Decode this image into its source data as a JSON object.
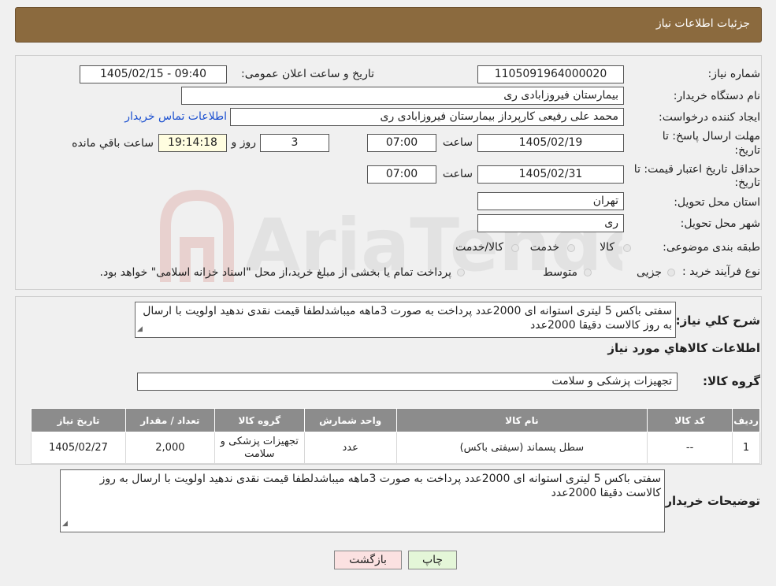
{
  "header": {
    "title": "جزئیات اطلاعات نیاز"
  },
  "details": {
    "need_number_label": "شماره نیاز:",
    "need_number": "1105091964000020",
    "announce_label": "تاریخ و ساعت اعلان عمومی:",
    "announce_value": "1405/02/15 - 09:40",
    "buyer_org_label": "نام دستگاه خریدار:",
    "buyer_org": "بیمارستان فیروزابادی ری",
    "creator_label": "ایجاد کننده درخواست:",
    "creator": "محمد علی رفیعی کارپرداز بیمارستان فیروزابادی ری",
    "contact_link": "اطلاعات تماس خریدار",
    "deadline_label_1": "مهلت ارسال پاسخ: تا",
    "deadline_label_2": "تاریخ:",
    "deadline_date": "1405/02/19",
    "time_label": "ساعت",
    "deadline_time": "07:00",
    "days_value": "3",
    "days_label": "روز و",
    "remaining_time": "19:14:18",
    "remaining_label": "ساعت باقي مانده",
    "validity_label_1": "حداقل تاریخ اعتبار قیمت: تا",
    "validity_label_2": "تاریخ:",
    "validity_date": "1405/02/31",
    "validity_time_label": "ساعت",
    "validity_time": "07:00",
    "province_label": "استان محل تحویل:",
    "province": "تهران",
    "city_label": "شهر محل تحویل:",
    "city": "ری",
    "category_label": "طبقه بندی موضوعی:",
    "category_options": [
      "کالا",
      "خدمت",
      "کالا/خدمت"
    ],
    "process_label": "نوع فرآیند خرید :",
    "process_options": [
      "جزیی",
      "متوسط"
    ],
    "process_note": "پرداخت تمام یا بخشی از مبلغ خرید،از محل \"اسناد خزانه اسلامی\" خواهد بود."
  },
  "description": {
    "label": "شرح کلي نياز:",
    "text": "سفتی باکس 5 لیتری  استوانه ای 2000عدد پرداخت به صورت 3ماهه میباشدلطفا قیمت نقدی ندهید  اولویت با ارسال به روز کالاست دقیقا 2000عدد"
  },
  "goods": {
    "section_title": "اطلاعات کالاهاي مورد نياز",
    "group_label": "گروه کالا:",
    "group_value": "تجهیزات پزشکی و سلامت",
    "columns": [
      "رديف",
      "کد کالا",
      "نام کالا",
      "واحد شمارش",
      "گروه کالا",
      "تعداد / مقدار",
      "تاریخ نیاز"
    ],
    "rows": [
      [
        "1",
        "--",
        "سطل پسماند (سیفتی باکس)",
        "عدد",
        "تجهیزات پزشکی و سلامت",
        "2,000",
        "1405/02/27"
      ]
    ]
  },
  "buyer_notes": {
    "label": "توضیحات خریدار:",
    "text": "سفتی باکس 5 لیتری  استوانه ای 2000عدد پرداخت به صورت 3ماهه میباشدلطفا قیمت نقدی ندهید  اولویت با ارسال به روز کالاست دقیقا 2000عدد"
  },
  "buttons": {
    "print": "چاپ",
    "back": "بازگشت"
  },
  "watermark": {
    "text": "AriaTender.neT"
  },
  "colors": {
    "header": "#8b6a3e",
    "table_header": "#8c8c8c",
    "link": "#1a4fd0",
    "print_btn": "#e4f6d8",
    "back_btn": "#fbe1e1"
  }
}
